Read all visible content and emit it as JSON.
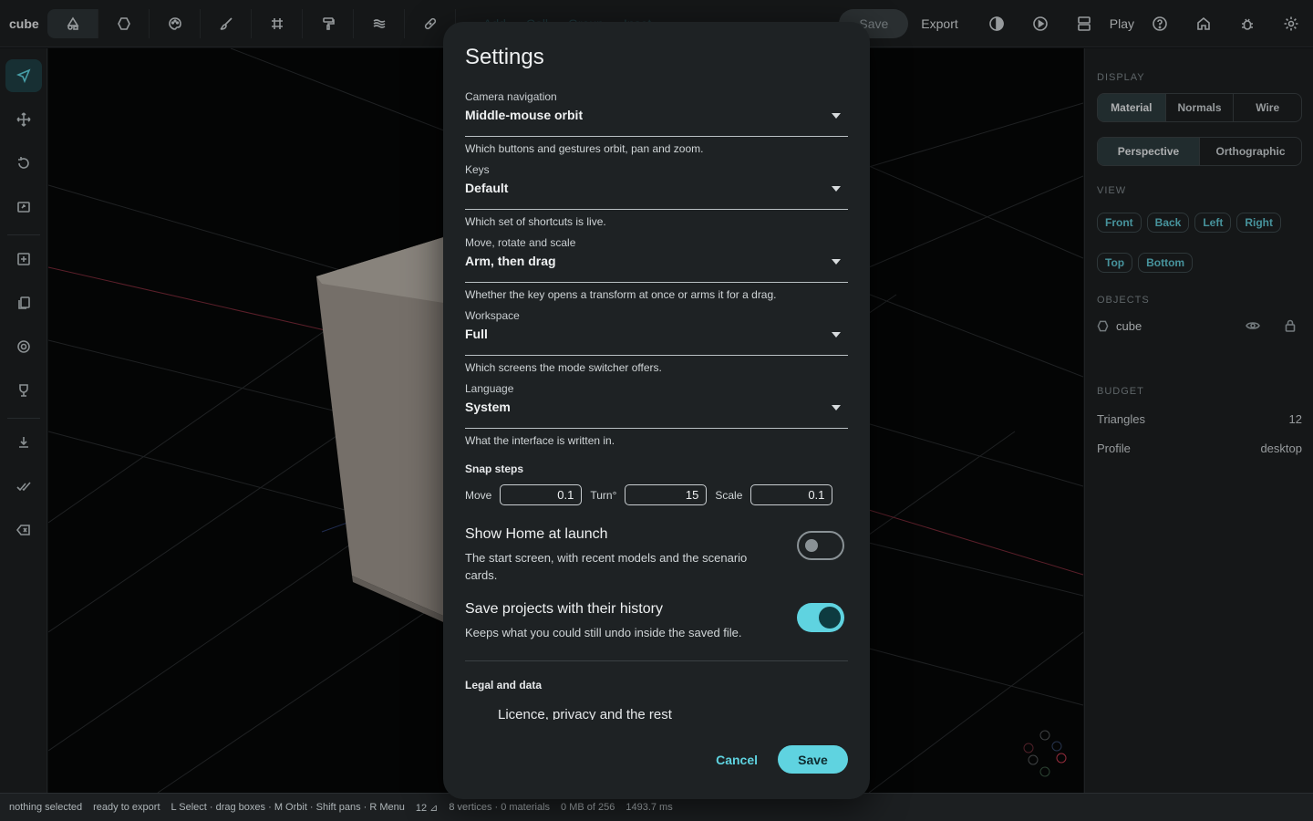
{
  "app": {
    "title": "cube"
  },
  "topbar": {
    "faded_items": [
      "Add",
      "Coll",
      "Group",
      "Inset"
    ],
    "save_label": "Save",
    "export_label": "Export",
    "play_label": "Play"
  },
  "viewport": {
    "gizmo": {
      "x_color": "#c43b4f",
      "y_color": "#4fbf7a",
      "z_color": "#4f7bd0"
    }
  },
  "panel": {
    "display_label": "Display",
    "display_modes": [
      "Material",
      "Normals",
      "Wire"
    ],
    "display_selected": "Material",
    "projection_modes": [
      "Perspective",
      "Orthographic"
    ],
    "projection_selected": "Perspective",
    "view_label": "View",
    "view_chips_row1": [
      "Front",
      "Back",
      "Left",
      "Right"
    ],
    "view_chips_row2": [
      "Top",
      "Bottom"
    ],
    "objects_label": "Objects",
    "object_name": "cube",
    "budget_label": "Budget",
    "triangles_label": "Triangles",
    "triangles_value": "12",
    "profile_label": "Profile",
    "profile_value": "desktop"
  },
  "status": {
    "selection": "nothing selected",
    "export_state": "ready to export",
    "hints": "L Select · drag boxes · M Orbit · Shift pans · R Menu",
    "triangles": "12 ⊿",
    "counts": "8 vertices · 0 materials",
    "memory": "0 MB of 256",
    "frame_time": "1493.7 ms"
  },
  "settings": {
    "title": "Settings",
    "fields": [
      {
        "label": "Camera navigation",
        "value": "Middle-mouse orbit",
        "hint": "Which buttons and gestures orbit, pan and zoom."
      },
      {
        "label": "Keys",
        "value": "Default",
        "hint": "Which set of shortcuts is live."
      },
      {
        "label": "Move, rotate and scale",
        "value": "Arm, then drag",
        "hint": "Whether the key opens a transform at once or arms it for a drag."
      },
      {
        "label": "Workspace",
        "value": "Full",
        "hint": "Which screens the mode switcher offers."
      },
      {
        "label": "Language",
        "value": "System",
        "hint": "What the interface is written in."
      }
    ],
    "snap": {
      "heading": "Snap steps",
      "move_label": "Move",
      "move_value": "0.1",
      "turn_label": "Turn°",
      "turn_value": "15",
      "scale_label": "Scale",
      "scale_value": "0.1"
    },
    "home_toggle": {
      "title": "Show Home at launch",
      "desc": "The start screen, with recent models and the scenario cards.",
      "on": false
    },
    "history_toggle": {
      "title": "Save projects with their history",
      "desc": "Keeps what you could still undo inside the saved file.",
      "on": true
    },
    "legal_heading": "Legal and data",
    "legal_link": "Licence, privacy and the rest",
    "cancel_label": "Cancel",
    "save_label": "Save"
  },
  "colors": {
    "accent": "#5fd3e0",
    "dialog_bg": "#1e2224",
    "chrome_bg": "#1c1f21"
  }
}
